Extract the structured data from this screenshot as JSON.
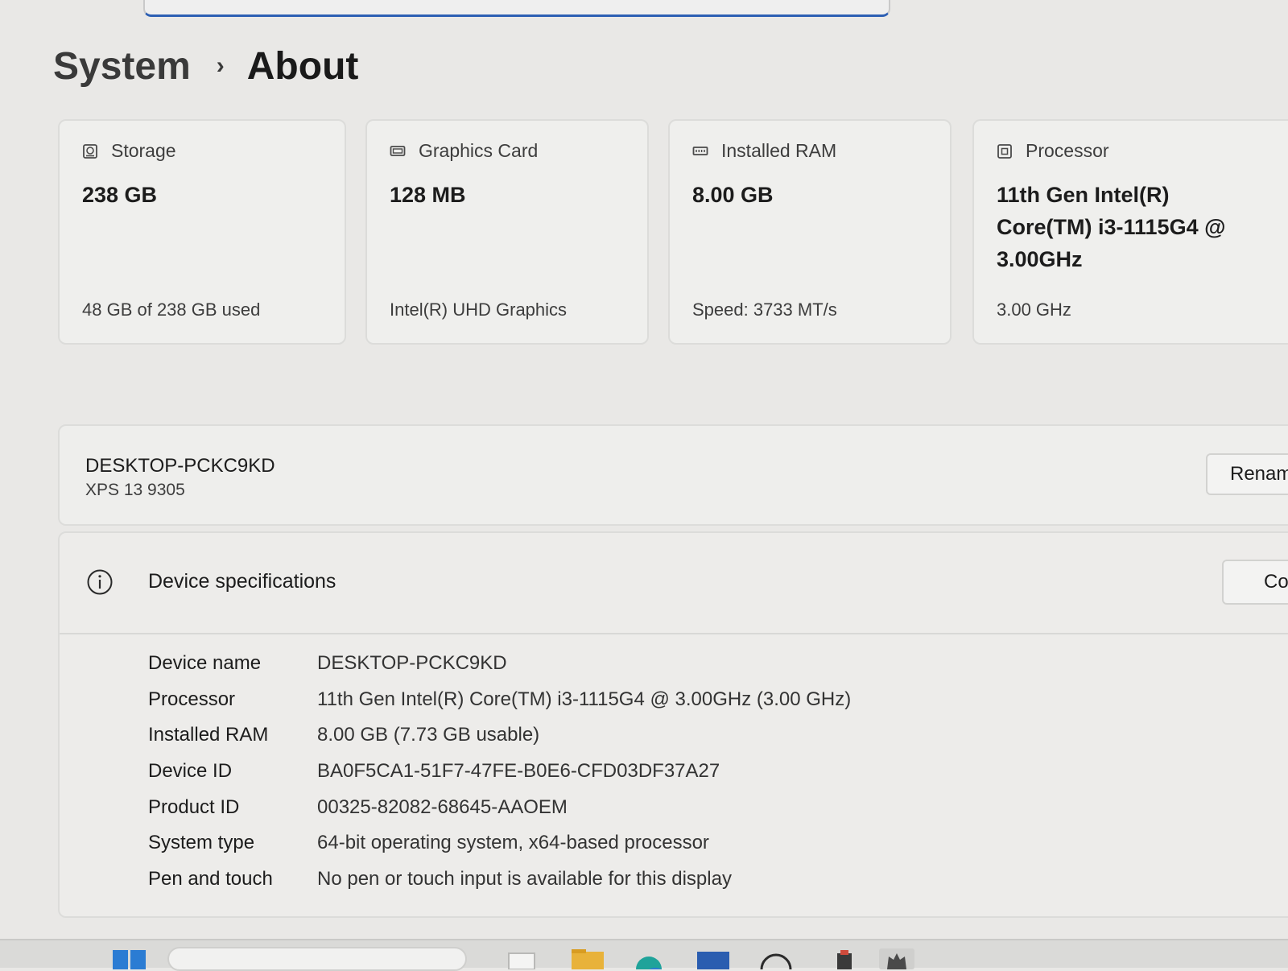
{
  "breadcrumb": {
    "parent": "System",
    "separator": "›",
    "current": "About"
  },
  "cards": {
    "storage": {
      "label": "Storage",
      "value": "238 GB",
      "sub": "48 GB of 238 GB used",
      "icon": "storage-drive-icon",
      "used_fraction": 0.2017
    },
    "graphics": {
      "label": "Graphics Card",
      "value": "128 MB",
      "sub": "Intel(R) UHD Graphics",
      "icon": "graphics-card-icon"
    },
    "ram": {
      "label": "Installed RAM",
      "value": "8.00 GB",
      "sub": "Speed: 3733 MT/s",
      "icon": "memory-icon"
    },
    "processor": {
      "label": "Processor",
      "value": "11th Gen Intel(R) Core(TM) i3-1115G4 @ 3.00GHz",
      "sub": "3.00 GHz",
      "icon": "processor-chip-icon"
    }
  },
  "device": {
    "name": "DESKTOP-PCKC9KD",
    "model": "XPS 13 9305",
    "rename_label": "Renam"
  },
  "specs": {
    "title": "Device specifications",
    "copy_label": "Co",
    "icon": "info-icon",
    "rows": [
      {
        "label": "Device name",
        "value": "DESKTOP-PCKC9KD"
      },
      {
        "label": "Processor",
        "value": "11th Gen Intel(R) Core(TM) i3-1115G4 @ 3.00GHz (3.00 GHz)"
      },
      {
        "label": "Installed RAM",
        "value": "8.00 GB (7.73 GB usable)"
      },
      {
        "label": "Device ID",
        "value": "BA0F5CA1-51F7-47FE-B0E6-CFD03DF37A27"
      },
      {
        "label": "Product ID",
        "value": "00325-82082-68645-AAOEM"
      },
      {
        "label": "System type",
        "value": "64-bit operating system, x64-based processor"
      },
      {
        "label": "Pen and touch",
        "value": "No pen or touch input is available for this display"
      }
    ]
  },
  "taskbar": {
    "items": [
      "start-icon",
      "search-box",
      "task-view-icon",
      "file-explorer-icon",
      "edge-icon",
      "store-icon",
      "app-icon",
      "settings-icon"
    ],
    "colors": {
      "start": "#2b7cd3",
      "explorer": "#e8b23a",
      "edge": "#1fa39a",
      "store": "#2a5db0"
    }
  }
}
